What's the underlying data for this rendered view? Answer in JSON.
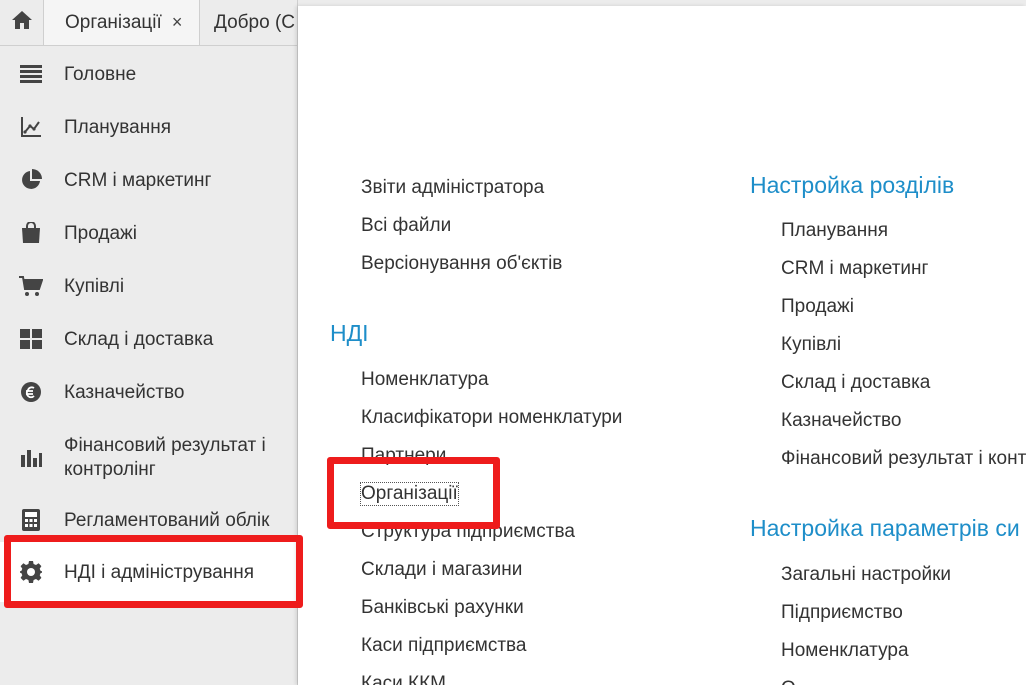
{
  "tabs": [
    {
      "label": "Організації",
      "close": "×"
    },
    {
      "label": "Добро (С"
    }
  ],
  "sidebar": {
    "items": [
      {
        "label": "Головне",
        "icon": "menu-lines-icon"
      },
      {
        "label": "Планування",
        "icon": "planning-chart-icon"
      },
      {
        "label": "CRM і маркетинг",
        "icon": "pie-chart-icon"
      },
      {
        "label": "Продажі",
        "icon": "shopping-bag-icon"
      },
      {
        "label": "Купівлі",
        "icon": "cart-icon"
      },
      {
        "label": "Склад і доставка",
        "icon": "warehouse-grid-icon"
      },
      {
        "label": "Казначейство",
        "icon": "currency-coin-icon"
      },
      {
        "label": "Фінансовий результат і контролінг",
        "line1": "Фінансовий результат і",
        "line2": "контролінг",
        "icon": "bar-chart-icon"
      },
      {
        "label": "Регламентований облік",
        "icon": "calculator-icon"
      },
      {
        "label": "НДІ і адміністрування",
        "icon": "gear-icon"
      }
    ]
  },
  "panel": {
    "col1_top_links": [
      "Звіти адміністратора",
      "Всі файли",
      "Версіонування об'єктів"
    ],
    "ndi": {
      "title": "НДІ",
      "links": [
        "Номенклатура",
        "Класифікатори номенклатури",
        "Партнери",
        "Організації",
        "Структура підприємства",
        "Склади і магазини",
        "Банківські рахунки",
        "Каси підприємства",
        "Каси ККМ"
      ]
    },
    "section_settings": {
      "title": "Настройка розділів",
      "links": [
        "Планування",
        "CRM і маркетинг",
        "Продажі",
        "Купівлі",
        "Склад і доставка",
        "Казначейство",
        "Фінансовий результат і конт"
      ]
    },
    "params_settings": {
      "title": "Настройка параметрів си",
      "links": [
        "Загальні настройки",
        "Підприємство",
        "Номенклатура",
        "О"
      ]
    }
  },
  "colors": {
    "accent": "#1e8ec9",
    "highlight": "#ee1c1c",
    "sidebar_bg": "#ececec"
  }
}
